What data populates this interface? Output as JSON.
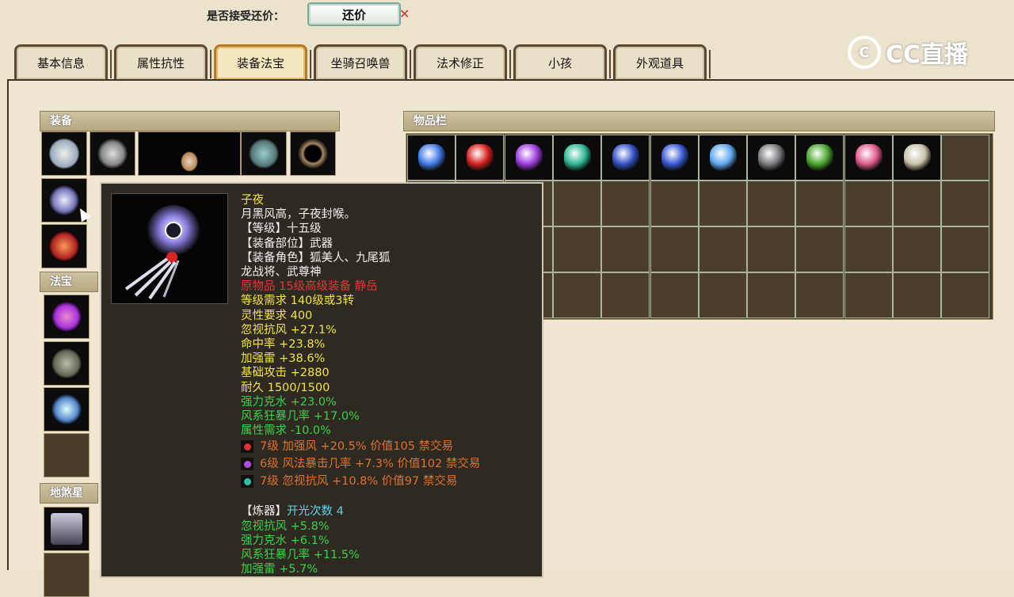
{
  "bargain": {
    "label": "是否接受还价：",
    "button": "还价",
    "close": "✕"
  },
  "tabs": [
    "基本信息",
    "属性抗性",
    "装备法宝",
    "坐骑召唤兽",
    "法术修正",
    "小孩",
    "外观道具"
  ],
  "active_tab_index": 2,
  "logo": {
    "mark": "C",
    "text": "CC直播"
  },
  "panels": {
    "equipment_title": "装备",
    "fabao_title": "法宝",
    "star_title": "地煞星",
    "inventory_title": "物品栏"
  },
  "tooltip": {
    "name": "子夜",
    "desc": "月黑风高，子夜封喉。",
    "level": "【等级】十五级",
    "slot": "【装备部位】武器",
    "role": "【装备角色】狐美人、九尾狐",
    "role2": "龙战将、武尊神",
    "origin": "原物品 15级高级装备 静岳",
    "req_level": "等级需求 140级或3转",
    "req_spirit": "灵性要求 400",
    "stat1": "忽视抗风 +27.1%",
    "stat2": "命中率 +23.8%",
    "stat3": "加强雷 +38.6%",
    "stat4": "基础攻击 +2880",
    "stat5": "耐久 1500/1500",
    "green1": "强力克水 +23.0%",
    "green2": "风系狂暴几率 +17.0%",
    "green3": "属性需求 -10.0%",
    "gems": [
      {
        "text": "7级 加强风 +20.5% 价值105 禁交易",
        "color": "#e23030"
      },
      {
        "text": "6级 风法暴击几率 +7.3% 价值102 禁交易",
        "color": "#b54ce0"
      },
      {
        "text": "7级 忽视抗风 +10.8% 价值97 禁交易",
        "color": "#2fc0a0"
      }
    ],
    "refine_label": "【炼器】",
    "refine_count": "开光次数 4",
    "refine1": "忽视抗风 +5.8%",
    "refine2": "强力克水 +6.1%",
    "refine3": "风系狂暴几率 +11.5%",
    "refine4": "加强雷 +5.7%"
  },
  "inventory_items": [
    {
      "name": "blue-gem-icon",
      "color": "#3f7be8"
    },
    {
      "name": "red-gem-icon",
      "color": "#d8201c"
    },
    {
      "name": "purple-gem-icon",
      "color": "#a13de0"
    },
    {
      "name": "teal-gem-icon",
      "color": "#2fb896"
    },
    {
      "name": "blue-robe-icon",
      "color": "#3452c8"
    },
    {
      "name": "blue-robe-icon",
      "color": "#3a5ad6"
    },
    {
      "name": "ice-crystal-icon",
      "color": "#5fa8f0"
    },
    {
      "name": "dark-helmet-icon",
      "color": "#7b7b80"
    },
    {
      "name": "green-wreath-icon",
      "color": "#4ba62e"
    },
    {
      "name": "pink-necklace-icon",
      "color": "#e05a8c"
    },
    {
      "name": "boots-icon",
      "color": "#c9c2a8"
    }
  ]
}
